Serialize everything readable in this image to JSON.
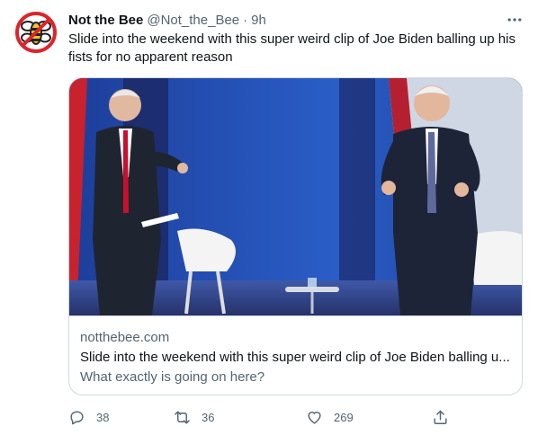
{
  "author": {
    "name": "Not the Bee",
    "handle": "@Not_the_Bee",
    "separator": "·",
    "time": "9h"
  },
  "tweet_text": "Slide into the weekend with this super weird clip of Joe Biden balling up his fists for no apparent reason",
  "card": {
    "domain": "notthebee.com",
    "title": "Slide into the weekend with this super weird clip of Joe Biden balling u...",
    "description": "What exactly is going on here?"
  },
  "actions": {
    "replies": "38",
    "retweets": "36",
    "likes": "269"
  },
  "colors": {
    "text": "#0f1419",
    "secondary": "#536471",
    "border": "#cfd9de",
    "logo_red": "#d9262c",
    "logo_yellow": "#f5c22b"
  },
  "icons": [
    "logo-bee-icon",
    "more-icon",
    "reply-icon",
    "retweet-icon",
    "like-icon",
    "share-icon"
  ]
}
